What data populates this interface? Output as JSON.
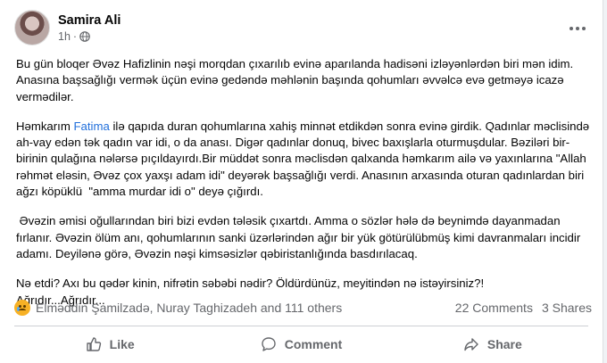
{
  "post": {
    "author": "Samira Ali",
    "time": "1h",
    "separator": "·",
    "paragraphs": {
      "p1": "Bu gün bloqer Əvəz Hafizlinin nəşi morqdan çıxarılıb evinə aparılanda hadisəni izləyənlərdən biri mən idim. Anasına başsağlığı vermək üçün evinə gedəndə məhlənin başında qohumları əvvəlcə evə getməyə icazə vermədilər.",
      "p2_before": "Həmkarım ",
      "p2_mention": "Fatima",
      "p2_after": " ilə qapıda duran qohumlarına xahiş minnət etdikdən sonra evinə girdik. Qadınlar məclisində ah-vay edən tək qadın var idi, o da anası. Digər qadınlar donuq, bivec baxışlarla oturmuşdular. Bəziləri bir-birinin qulağına nələrsə pıçıldayırdı.Bir müddət sonra məclisdən qalxanda həmkarım ailə və yaxınlarına \"Allah rəhmət eləsin, Əvəz çox yaxşı adam idi\" deyərək başsağlığı verdi. Anasının arxasında oturan qadınlardan biri ağzı köpüklü  \"amma murdar idi o\" deyə çığırdı.",
      "p3": " Əvəzin əmisi oğullarından biri bizi evdən tələsik çıxartdı. Amma o sözlər hələ də beynimdə dayanmadan fırlanır. Əvəzin ölüm anı, qohumlarının sanki üzərlərindən ağır bir yük götürülübmüş kimi davranmaları incidir adamı. Deyilənə görə, Əvəzin nəşi kimsəsizlər qəbiristanlığında basdırılacaq.",
      "p4_line1": "Nə etdi? Axı bu qədər kinin, nifrətin səbəbi nədir? Öldürdünüz, meyitindən nə istəyirsiniz?!",
      "p4_line2": "Ağrıdır...Ağrıdır..."
    },
    "reactions": {
      "reactors": "Elməddin Şamilzadə, Nuray Taghizadeh and 111 others",
      "comments": "22 Comments",
      "shares": "3 Shares"
    },
    "actions": {
      "like": "Like",
      "comment": "Comment",
      "share": "Share"
    },
    "icons": {
      "globe": "globe-icon",
      "more": "more-options-icon",
      "reaction": "sad-reaction-icon",
      "like": "thumbs-up-icon",
      "comment": "comment-bubble-icon",
      "share": "share-arrow-icon"
    },
    "colors": {
      "mention": "#216fdb",
      "secondary_text": "#65676b"
    }
  }
}
